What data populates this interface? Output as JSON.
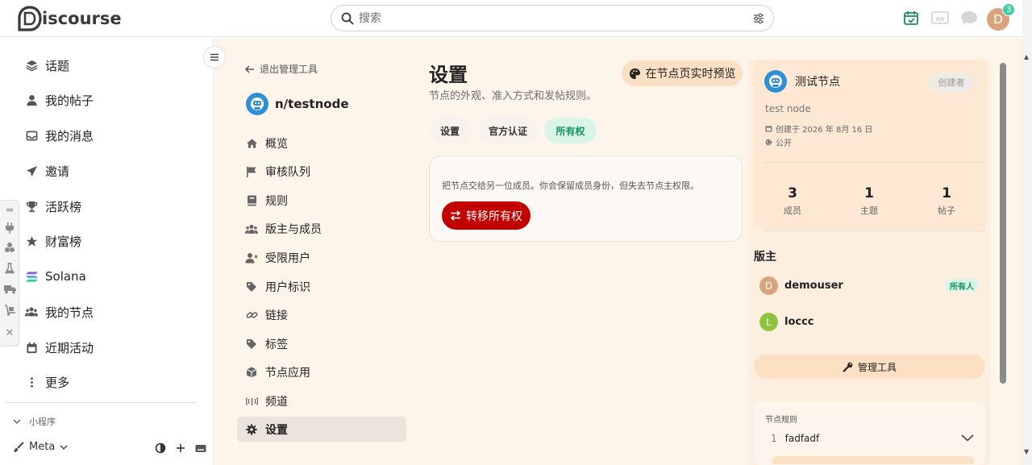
{
  "header": {
    "logo_text": "iscourse",
    "search_placeholder": "搜索",
    "avatar_letter": "D",
    "notification_count": "3"
  },
  "sidebar": {
    "items": [
      {
        "label": "话题",
        "icon": "layers-icon"
      },
      {
        "label": "我的帖子",
        "icon": "user-icon"
      },
      {
        "label": "我的消息",
        "icon": "inbox-icon"
      },
      {
        "label": "邀请",
        "icon": "paper-plane-icon"
      },
      {
        "label": "活跃榜",
        "icon": "trophy-icon"
      },
      {
        "label": "财富榜",
        "icon": "star-icon"
      },
      {
        "label": "Solana",
        "icon": "solana-icon"
      },
      {
        "label": "我的节点",
        "icon": "users-icon"
      },
      {
        "label": "近期活动",
        "icon": "calendar-icon"
      },
      {
        "label": "更多",
        "icon": "ellipsis-vertical-icon"
      }
    ],
    "mini_section_label": "小程序",
    "meta_label": "Meta"
  },
  "node_nav": {
    "back_label": "退出管理工具",
    "node_name": "n/testnode",
    "items": [
      {
        "label": "概览",
        "icon": "home-icon"
      },
      {
        "label": "审核队列",
        "icon": "flag-icon"
      },
      {
        "label": "规则",
        "icon": "book-icon"
      },
      {
        "label": "版主与成员",
        "icon": "users-icon"
      },
      {
        "label": "受限用户",
        "icon": "user-x-icon"
      },
      {
        "label": "用户标识",
        "icon": "tags-icon"
      },
      {
        "label": "链接",
        "icon": "link-icon"
      },
      {
        "label": "标签",
        "icon": "tag-icon"
      },
      {
        "label": "节点应用",
        "icon": "cube-icon"
      },
      {
        "label": "频道",
        "icon": "antenna-icon"
      },
      {
        "label": "设置",
        "icon": "gear-icon"
      }
    ]
  },
  "settings": {
    "title": "设置",
    "subtitle": "节点的外观、准入方式和发帖规则。",
    "preview_button": "在节点页实时预览",
    "tabs": [
      "设置",
      "官方认证",
      "所有权"
    ],
    "active_tab": "所有权",
    "ownership_text": "把节点交给另一位成员。你会保留成员身份，但失去节点主权限。",
    "transfer_button": "转移所有权"
  },
  "node_panel": {
    "name": "测试节点",
    "creator_label": "创建者",
    "description": "test node",
    "created": "创建于 2026 年 8月 16 日",
    "visibility": "公开",
    "stats": [
      {
        "value": "3",
        "label": "成员"
      },
      {
        "value": "1",
        "label": "主题"
      },
      {
        "value": "1",
        "label": "帖子"
      }
    ],
    "moderators_title": "版主",
    "moderators": [
      {
        "initial": "D",
        "name": "demouser",
        "color": "#d9a47c"
      },
      {
        "initial": "L",
        "name": "loccc",
        "color": "#8fc23e"
      }
    ],
    "owner_badge": "所有人",
    "manage_button": "管理工具",
    "rules_title": "节点规则",
    "rules": [
      {
        "num": "1",
        "text": "fadfadf"
      }
    ]
  },
  "colors": {
    "accent": "#c20000",
    "main_bg": "#fdf4ea",
    "active_tab_bg": "#d9f5e8",
    "active_tab_text": "#16915f"
  }
}
